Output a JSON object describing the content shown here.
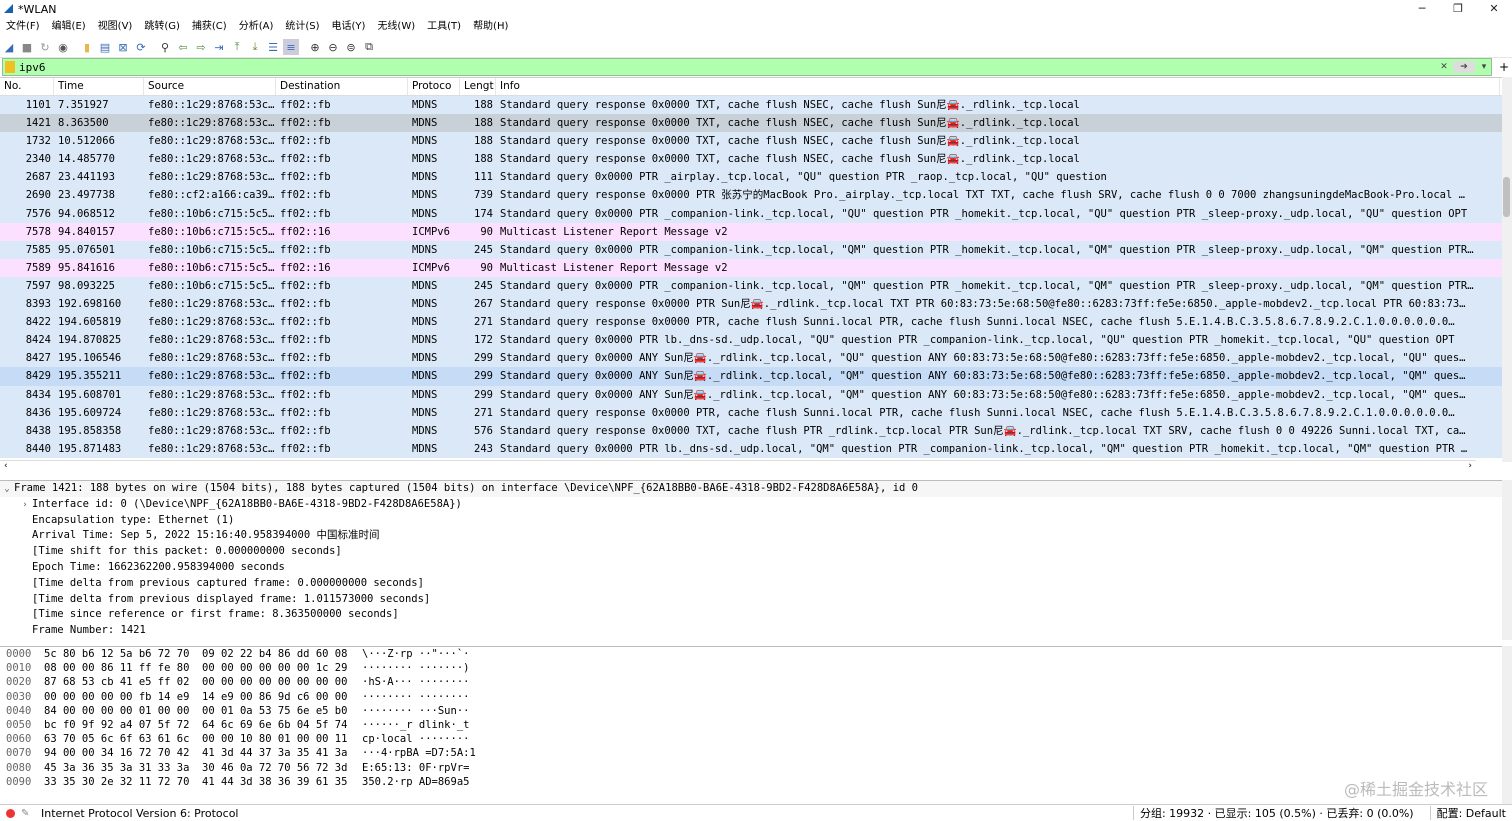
{
  "window": {
    "title": "*WLAN",
    "controls": [
      "─",
      "❐",
      "✕"
    ]
  },
  "menu": [
    "文件(F)",
    "编辑(E)",
    "视图(V)",
    "跳转(G)",
    "捕获(C)",
    "分析(A)",
    "统计(S)",
    "电话(Y)",
    "无线(W)",
    "工具(T)",
    "帮助(H)"
  ],
  "filter": {
    "value": "ipv6",
    "color": "#afffaf"
  },
  "columns": {
    "no": "No.",
    "time": "Time",
    "source": "Source",
    "destination": "Destination",
    "protocol": "Protoco",
    "length": "Lengt",
    "info": "Info"
  },
  "packets": [
    {
      "no": "1101",
      "time": "7.351927",
      "src": "fe80::1c29:8768:53c…",
      "dst": "ff02::fb",
      "proto": "MDNS",
      "len": "188",
      "info": "Standard query response 0x0000 TXT, cache flush NSEC, cache flush Sun尼🚘._rdlink._tcp.local",
      "cls": "mdns"
    },
    {
      "no": "1421",
      "time": "8.363500",
      "src": "fe80::1c29:8768:53c…",
      "dst": "ff02::fb",
      "proto": "MDNS",
      "len": "188",
      "info": "Standard query response 0x0000 TXT, cache flush NSEC, cache flush Sun尼🚘._rdlink._tcp.local",
      "cls": "sel"
    },
    {
      "no": "1732",
      "time": "10.512066",
      "src": "fe80::1c29:8768:53c…",
      "dst": "ff02::fb",
      "proto": "MDNS",
      "len": "188",
      "info": "Standard query response 0x0000 TXT, cache flush NSEC, cache flush Sun尼🚘._rdlink._tcp.local",
      "cls": "mdns"
    },
    {
      "no": "2340",
      "time": "14.485770",
      "src": "fe80::1c29:8768:53c…",
      "dst": "ff02::fb",
      "proto": "MDNS",
      "len": "188",
      "info": "Standard query response 0x0000 TXT, cache flush NSEC, cache flush Sun尼🚘._rdlink._tcp.local",
      "cls": "mdns"
    },
    {
      "no": "2687",
      "time": "23.441193",
      "src": "fe80::1c29:8768:53c…",
      "dst": "ff02::fb",
      "proto": "MDNS",
      "len": "111",
      "info": "Standard query 0x0000 PTR _airplay._tcp.local, \"QU\" question PTR _raop._tcp.local, \"QU\" question",
      "cls": "mdns"
    },
    {
      "no": "2690",
      "time": "23.497738",
      "src": "fe80::cf2:a166:ca39…",
      "dst": "ff02::fb",
      "proto": "MDNS",
      "len": "739",
      "info": "Standard query response 0x0000 PTR 张苏宁的MacBook Pro._airplay._tcp.local TXT TXT, cache flush SRV, cache flush 0 0 7000 zhangsuningdeMacBook-Pro.local …",
      "cls": "mdns"
    },
    {
      "no": "7576",
      "time": "94.068512",
      "src": "fe80::10b6:c715:5c5…",
      "dst": "ff02::fb",
      "proto": "MDNS",
      "len": "174",
      "info": "Standard query 0x0000 PTR _companion-link._tcp.local, \"QU\" question PTR _homekit._tcp.local, \"QU\" question PTR _sleep-proxy._udp.local, \"QU\" question OPT",
      "cls": "mdns"
    },
    {
      "no": "7578",
      "time": "94.840157",
      "src": "fe80::10b6:c715:5c5…",
      "dst": "ff02::16",
      "proto": "ICMPv6",
      "len": "90",
      "info": "Multicast Listener Report Message v2",
      "cls": "icmp"
    },
    {
      "no": "7585",
      "time": "95.076501",
      "src": "fe80::10b6:c715:5c5…",
      "dst": "ff02::fb",
      "proto": "MDNS",
      "len": "245",
      "info": "Standard query 0x0000 PTR _companion-link._tcp.local, \"QM\" question PTR _homekit._tcp.local, \"QM\" question PTR _sleep-proxy._udp.local, \"QM\" question PTR…",
      "cls": "mdns"
    },
    {
      "no": "7589",
      "time": "95.841616",
      "src": "fe80::10b6:c715:5c5…",
      "dst": "ff02::16",
      "proto": "ICMPv6",
      "len": "90",
      "info": "Multicast Listener Report Message v2",
      "cls": "icmp"
    },
    {
      "no": "7597",
      "time": "98.093225",
      "src": "fe80::10b6:c715:5c5…",
      "dst": "ff02::fb",
      "proto": "MDNS",
      "len": "245",
      "info": "Standard query 0x0000 PTR _companion-link._tcp.local, \"QM\" question PTR _homekit._tcp.local, \"QM\" question PTR _sleep-proxy._udp.local, \"QM\" question PTR…",
      "cls": "mdns"
    },
    {
      "no": "8393",
      "time": "192.698160",
      "src": "fe80::1c29:8768:53c…",
      "dst": "ff02::fb",
      "proto": "MDNS",
      "len": "267",
      "info": "Standard query response 0x0000 PTR Sun尼🚘._rdlink._tcp.local TXT PTR 60:83:73:5e:68:50@fe80::6283:73ff:fe5e:6850._apple-mobdev2._tcp.local PTR 60:83:73…",
      "cls": "mdns"
    },
    {
      "no": "8422",
      "time": "194.605819",
      "src": "fe80::1c29:8768:53c…",
      "dst": "ff02::fb",
      "proto": "MDNS",
      "len": "271",
      "info": "Standard query response 0x0000 PTR, cache flush Sunni.local PTR, cache flush Sunni.local NSEC, cache flush 5.E.1.4.B.C.3.5.8.6.7.8.9.2.C.1.0.0.0.0.0.0…",
      "cls": "mdns"
    },
    {
      "no": "8424",
      "time": "194.870825",
      "src": "fe80::1c29:8768:53c…",
      "dst": "ff02::fb",
      "proto": "MDNS",
      "len": "172",
      "info": "Standard query 0x0000 PTR lb._dns-sd._udp.local, \"QU\" question PTR _companion-link._tcp.local, \"QU\" question PTR _homekit._tcp.local, \"QU\" question OPT",
      "cls": "mdns"
    },
    {
      "no": "8427",
      "time": "195.106546",
      "src": "fe80::1c29:8768:53c…",
      "dst": "ff02::fb",
      "proto": "MDNS",
      "len": "299",
      "info": "Standard query 0x0000 ANY Sun尼🚘._rdlink._tcp.local, \"QU\" question ANY 60:83:73:5e:68:50@fe80::6283:73ff:fe5e:6850._apple-mobdev2._tcp.local, \"QU\" ques…",
      "cls": "mdns"
    },
    {
      "no": "8429",
      "time": "195.355211",
      "src": "fe80::1c29:8768:53c…",
      "dst": "ff02::fb",
      "proto": "MDNS",
      "len": "299",
      "info": "Standard query 0x0000 ANY Sun尼🚘._rdlink._tcp.local, \"QM\" question ANY 60:83:73:5e:68:50@fe80::6283:73ff:fe5e:6850._apple-mobdev2._tcp.local, \"QM\" ques…",
      "cls": "hl"
    },
    {
      "no": "8434",
      "time": "195.608701",
      "src": "fe80::1c29:8768:53c…",
      "dst": "ff02::fb",
      "proto": "MDNS",
      "len": "299",
      "info": "Standard query 0x0000 ANY Sun尼🚘._rdlink._tcp.local, \"QM\" question ANY 60:83:73:5e:68:50@fe80::6283:73ff:fe5e:6850._apple-mobdev2._tcp.local, \"QM\" ques…",
      "cls": "mdns"
    },
    {
      "no": "8436",
      "time": "195.609724",
      "src": "fe80::1c29:8768:53c…",
      "dst": "ff02::fb",
      "proto": "MDNS",
      "len": "271",
      "info": "Standard query response 0x0000 PTR, cache flush Sunni.local PTR, cache flush Sunni.local NSEC, cache flush 5.E.1.4.B.C.3.5.8.6.7.8.9.2.C.1.0.0.0.0.0.0…",
      "cls": "mdns"
    },
    {
      "no": "8438",
      "time": "195.858358",
      "src": "fe80::1c29:8768:53c…",
      "dst": "ff02::fb",
      "proto": "MDNS",
      "len": "576",
      "info": "Standard query response 0x0000 TXT, cache flush PTR _rdlink._tcp.local PTR Sun尼🚘._rdlink._tcp.local TXT SRV, cache flush 0 0 49226 Sunni.local TXT, ca…",
      "cls": "mdns"
    },
    {
      "no": "8440",
      "time": "195.871483",
      "src": "fe80::1c29:8768:53c…",
      "dst": "ff02::fb",
      "proto": "MDNS",
      "len": "243",
      "info": "Standard query 0x0000 PTR lb._dns-sd._udp.local, \"QM\" question PTR _companion-link._tcp.local, \"QM\" question PTR _homekit._tcp.local, \"QM\" question PTR …",
      "cls": "mdns"
    }
  ],
  "details": [
    {
      "tw": "⌄",
      "text": "Frame 1421: 188 bytes on wire (1504 bits), 188 bytes captured (1504 bits) on interface \\Device\\NPF_{62A18BB0-BA6E-4318-9BD2-F428D8A6E58A}, id 0",
      "top": true
    },
    {
      "tw": "›",
      "text": "Interface id: 0 (\\Device\\NPF_{62A18BB0-BA6E-4318-9BD2-F428D8A6E58A})"
    },
    {
      "tw": "",
      "text": "Encapsulation type: Ethernet (1)"
    },
    {
      "tw": "",
      "text": "Arrival Time: Sep  5, 2022 15:16:40.958394000 中国标准时间"
    },
    {
      "tw": "",
      "text": "[Time shift for this packet: 0.000000000 seconds]"
    },
    {
      "tw": "",
      "text": "Epoch Time: 1662362200.958394000 seconds"
    },
    {
      "tw": "",
      "text": "[Time delta from previous captured frame: 0.000000000 seconds]"
    },
    {
      "tw": "",
      "text": "[Time delta from previous displayed frame: 1.011573000 seconds]"
    },
    {
      "tw": "",
      "text": "[Time since reference or first frame: 8.363500000 seconds]"
    },
    {
      "tw": "",
      "text": "Frame Number: 1421"
    }
  ],
  "bytes": [
    {
      "off": "0000",
      "hex": "5c 80 b6 12 5a b6 72 70  09 02 22 b4 86 dd 60 08",
      "asc": "\\···Z·rp ··\"···`·"
    },
    {
      "off": "0010",
      "hex": "08 00 00 86 11 ff fe 80  00 00 00 00 00 00 1c 29",
      "asc": "········ ·······)"
    },
    {
      "off": "0020",
      "hex": "87 68 53 cb 41 e5 ff 02  00 00 00 00 00 00 00 00",
      "asc": "·hS·A··· ········"
    },
    {
      "off": "0030",
      "hex": "00 00 00 00 00 fb 14 e9  14 e9 00 86 9d c6 00 00",
      "asc": "········ ········"
    },
    {
      "off": "0040",
      "hex": "84 00 00 00 00 01 00 00  00 01 0a 53 75 6e e5 b0",
      "asc": "········ ···Sun··"
    },
    {
      "off": "0050",
      "hex": "bc f0 9f 92 a4 07 5f 72  64 6c 69 6e 6b 04 5f 74",
      "asc": "······_r dlink·_t"
    },
    {
      "off": "0060",
      "hex": "63 70 05 6c 6f 63 61 6c  00 00 10 80 01 00 00 11",
      "asc": "cp·local ········"
    },
    {
      "off": "0070",
      "hex": "94 00 00 34 16 72 70 42  41 3d 44 37 3a 35 41 3a",
      "asc": "···4·rpBA =D7:5A:1"
    },
    {
      "off": "0080",
      "hex": "45 3a 36 35 3a 31 33 3a  30 46 0a 72 70 56 72 3d",
      "asc": "E:65:13: 0F·rpVr="
    },
    {
      "off": "0090",
      "hex": "33 35 30 2e 32 11 72 70  41 44 3d 38 36 39 61 35",
      "asc": "350.2·rp AD=869a5"
    }
  ],
  "watermark": "@稀土掘金技术社区",
  "status": {
    "text": "Internet Protocol Version 6: Protocol",
    "count": "分组: 19932 · 已显示: 105 (0.5%) · 已丢弃: 0 (0.0%)",
    "profile": "配置: Default"
  }
}
